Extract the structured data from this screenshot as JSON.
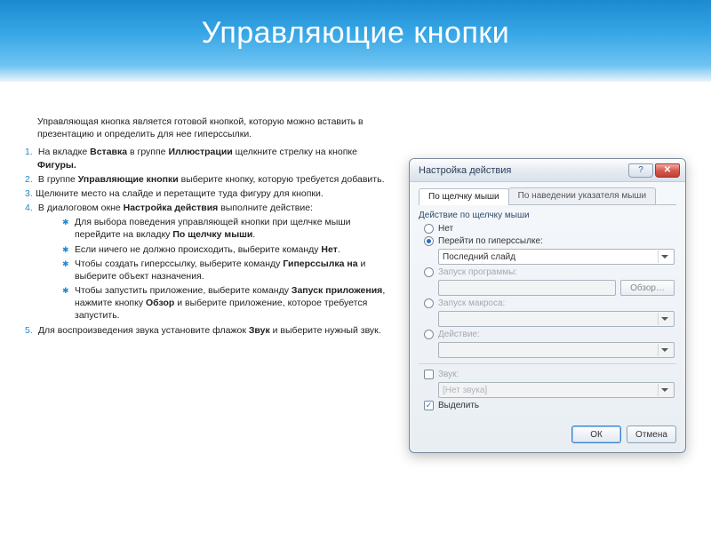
{
  "title": "Управляющие кнопки",
  "intro": "Управляющая кнопка является готовой кнопкой, которую можно вставить в презентацию и определить для нее гиперссылки.",
  "steps": {
    "s1_a": "На вкладке ",
    "s1_b": "Вставка",
    "s1_c": " в группе ",
    "s1_d": "Иллюстрации",
    "s1_e": " щелкните стрелку на кнопке ",
    "s1_f": "Фигуры.",
    "s2_a": "В группе ",
    "s2_b": "Управляющие кнопки",
    "s2_c": " выберите кнопку, которую требуется добавить.",
    "s3": "Щелкните место на слайде и перетащите туда фигуру для кнопки.",
    "s4_a": "В диалоговом окне ",
    "s4_b": "Настройка действия",
    "s4_c": " выполните действие:",
    "b1_a": "Для выбора поведения управляющей кнопки при щелчке мыши перейдите на вкладку ",
    "b1_b": "По щелчку мыши",
    "b1_c": ".",
    "b2_a": "Если ничего не должно происходить, выберите команду ",
    "b2_b": "Нет",
    "b2_c": ".",
    "b3_a": "Чтобы создать гиперссылку, выберите команду ",
    "b3_b": "Гиперссылка на",
    "b3_c": " и выберите объект назначения.",
    "b4_a": "Чтобы запустить приложение, выберите команду ",
    "b4_b": "Запуск приложения",
    "b4_c": ", нажмите кнопку ",
    "b4_d": "Обзор",
    "b4_e": " и выберите приложение, которое требуется запустить.",
    "s5_a": "Для воспроизведения звука установите флажок ",
    "s5_b": "Звук",
    "s5_c": " и выберите нужный звук."
  },
  "dialog": {
    "title": "Настройка действия",
    "tab_click": "По щелчку мыши",
    "tab_hover": "По наведении указателя мыши",
    "group_label": "Действие по щелчку мыши",
    "opt_none": "Нет",
    "opt_hyper_label": "Перейти по гиперссылке:",
    "hyper_value": "Последний слайд",
    "opt_program": "Запуск программы:",
    "browse": "Обзор…",
    "opt_macro": "Запуск макроса:",
    "opt_action": "Действие:",
    "sound_label": "Звук:",
    "sound_value": "[Нет звука]",
    "highlight": "Выделить",
    "ok": "ОК",
    "cancel": "Отмена"
  }
}
